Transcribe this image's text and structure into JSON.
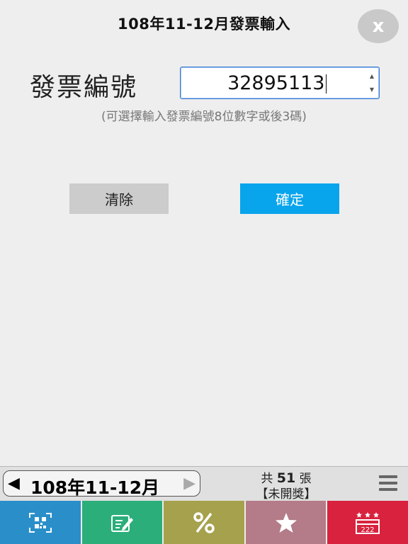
{
  "header": {
    "title": "108年11-12月發票輸入",
    "close_label": "x"
  },
  "form": {
    "label": "發票編號",
    "invoice_number": "32895113",
    "hint": "(可選擇輸入發票編號8位數字或後3碼)"
  },
  "buttons": {
    "clear": "清除",
    "confirm": "確定"
  },
  "bottom_bar": {
    "period": "108年11-12月",
    "prev_arrow": "◀",
    "next_arrow": "▶",
    "count_prefix": "共",
    "count": "51",
    "count_suffix": "張",
    "status": "【未開獎】"
  },
  "tabs": [
    {
      "icon": "qr-scan-icon",
      "color": "#2a8fc9"
    },
    {
      "icon": "edit-icon",
      "color": "#2bae7a"
    },
    {
      "icon": "percent-icon",
      "color": "#a5a14c"
    },
    {
      "icon": "star-icon",
      "color": "#b47b88"
    },
    {
      "icon": "lottery-icon",
      "color": "#d8223e"
    }
  ],
  "colors": {
    "confirm": "#08a4ec",
    "clear": "#cccccc",
    "background": "#eeeeee"
  }
}
